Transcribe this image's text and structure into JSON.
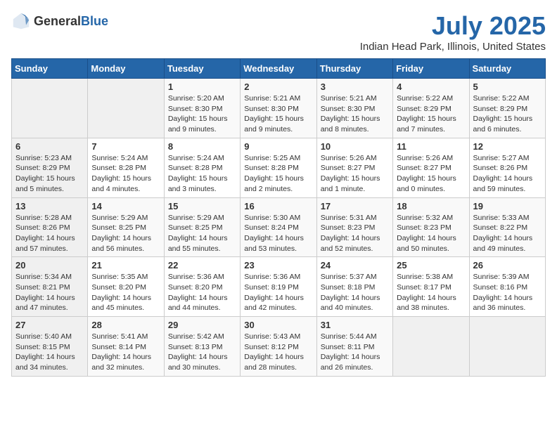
{
  "logo": {
    "general": "General",
    "blue": "Blue"
  },
  "title": "July 2025",
  "subtitle": "Indian Head Park, Illinois, United States",
  "weekdays": [
    "Sunday",
    "Monday",
    "Tuesday",
    "Wednesday",
    "Thursday",
    "Friday",
    "Saturday"
  ],
  "weeks": [
    [
      {
        "day": "",
        "info": ""
      },
      {
        "day": "",
        "info": ""
      },
      {
        "day": "1",
        "info": "Sunrise: 5:20 AM\nSunset: 8:30 PM\nDaylight: 15 hours\nand 9 minutes."
      },
      {
        "day": "2",
        "info": "Sunrise: 5:21 AM\nSunset: 8:30 PM\nDaylight: 15 hours\nand 9 minutes."
      },
      {
        "day": "3",
        "info": "Sunrise: 5:21 AM\nSunset: 8:30 PM\nDaylight: 15 hours\nand 8 minutes."
      },
      {
        "day": "4",
        "info": "Sunrise: 5:22 AM\nSunset: 8:29 PM\nDaylight: 15 hours\nand 7 minutes."
      },
      {
        "day": "5",
        "info": "Sunrise: 5:22 AM\nSunset: 8:29 PM\nDaylight: 15 hours\nand 6 minutes."
      }
    ],
    [
      {
        "day": "6",
        "info": "Sunrise: 5:23 AM\nSunset: 8:29 PM\nDaylight: 15 hours\nand 5 minutes."
      },
      {
        "day": "7",
        "info": "Sunrise: 5:24 AM\nSunset: 8:28 PM\nDaylight: 15 hours\nand 4 minutes."
      },
      {
        "day": "8",
        "info": "Sunrise: 5:24 AM\nSunset: 8:28 PM\nDaylight: 15 hours\nand 3 minutes."
      },
      {
        "day": "9",
        "info": "Sunrise: 5:25 AM\nSunset: 8:28 PM\nDaylight: 15 hours\nand 2 minutes."
      },
      {
        "day": "10",
        "info": "Sunrise: 5:26 AM\nSunset: 8:27 PM\nDaylight: 15 hours\nand 1 minute."
      },
      {
        "day": "11",
        "info": "Sunrise: 5:26 AM\nSunset: 8:27 PM\nDaylight: 15 hours\nand 0 minutes."
      },
      {
        "day": "12",
        "info": "Sunrise: 5:27 AM\nSunset: 8:26 PM\nDaylight: 14 hours\nand 59 minutes."
      }
    ],
    [
      {
        "day": "13",
        "info": "Sunrise: 5:28 AM\nSunset: 8:26 PM\nDaylight: 14 hours\nand 57 minutes."
      },
      {
        "day": "14",
        "info": "Sunrise: 5:29 AM\nSunset: 8:25 PM\nDaylight: 14 hours\nand 56 minutes."
      },
      {
        "day": "15",
        "info": "Sunrise: 5:29 AM\nSunset: 8:25 PM\nDaylight: 14 hours\nand 55 minutes."
      },
      {
        "day": "16",
        "info": "Sunrise: 5:30 AM\nSunset: 8:24 PM\nDaylight: 14 hours\nand 53 minutes."
      },
      {
        "day": "17",
        "info": "Sunrise: 5:31 AM\nSunset: 8:23 PM\nDaylight: 14 hours\nand 52 minutes."
      },
      {
        "day": "18",
        "info": "Sunrise: 5:32 AM\nSunset: 8:23 PM\nDaylight: 14 hours\nand 50 minutes."
      },
      {
        "day": "19",
        "info": "Sunrise: 5:33 AM\nSunset: 8:22 PM\nDaylight: 14 hours\nand 49 minutes."
      }
    ],
    [
      {
        "day": "20",
        "info": "Sunrise: 5:34 AM\nSunset: 8:21 PM\nDaylight: 14 hours\nand 47 minutes."
      },
      {
        "day": "21",
        "info": "Sunrise: 5:35 AM\nSunset: 8:20 PM\nDaylight: 14 hours\nand 45 minutes."
      },
      {
        "day": "22",
        "info": "Sunrise: 5:36 AM\nSunset: 8:20 PM\nDaylight: 14 hours\nand 44 minutes."
      },
      {
        "day": "23",
        "info": "Sunrise: 5:36 AM\nSunset: 8:19 PM\nDaylight: 14 hours\nand 42 minutes."
      },
      {
        "day": "24",
        "info": "Sunrise: 5:37 AM\nSunset: 8:18 PM\nDaylight: 14 hours\nand 40 minutes."
      },
      {
        "day": "25",
        "info": "Sunrise: 5:38 AM\nSunset: 8:17 PM\nDaylight: 14 hours\nand 38 minutes."
      },
      {
        "day": "26",
        "info": "Sunrise: 5:39 AM\nSunset: 8:16 PM\nDaylight: 14 hours\nand 36 minutes."
      }
    ],
    [
      {
        "day": "27",
        "info": "Sunrise: 5:40 AM\nSunset: 8:15 PM\nDaylight: 14 hours\nand 34 minutes."
      },
      {
        "day": "28",
        "info": "Sunrise: 5:41 AM\nSunset: 8:14 PM\nDaylight: 14 hours\nand 32 minutes."
      },
      {
        "day": "29",
        "info": "Sunrise: 5:42 AM\nSunset: 8:13 PM\nDaylight: 14 hours\nand 30 minutes."
      },
      {
        "day": "30",
        "info": "Sunrise: 5:43 AM\nSunset: 8:12 PM\nDaylight: 14 hours\nand 28 minutes."
      },
      {
        "day": "31",
        "info": "Sunrise: 5:44 AM\nSunset: 8:11 PM\nDaylight: 14 hours\nand 26 minutes."
      },
      {
        "day": "",
        "info": ""
      },
      {
        "day": "",
        "info": ""
      }
    ]
  ]
}
